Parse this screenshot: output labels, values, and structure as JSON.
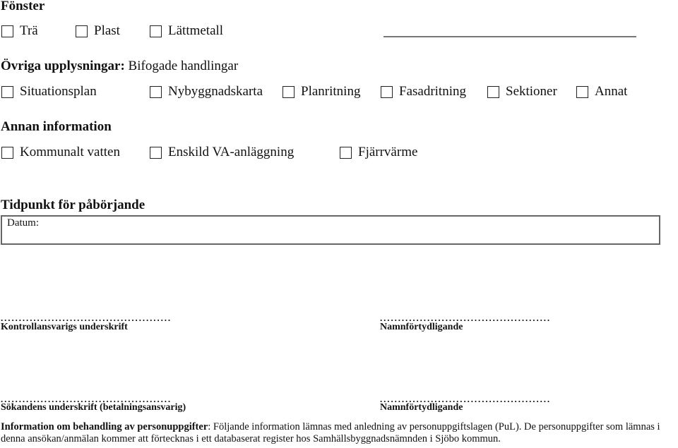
{
  "fonster": {
    "title": "Fönster",
    "options": [
      "Trä",
      "Plast",
      "Lättmetall"
    ]
  },
  "ovriga": {
    "title": "Övriga upplysningar:",
    "subtitle": "Bifogade handlingar",
    "options": [
      "Situationsplan",
      "Nybyggnadskarta",
      "Planritning",
      "Fasadritning",
      "Sektioner",
      "Annat"
    ]
  },
  "annan": {
    "title": "Annan information",
    "options": [
      "Kommunalt vatten",
      "Enskild VA-anläggning",
      "Fjärrvärme"
    ]
  },
  "tidpunkt": {
    "title": "Tidpunkt för påbörjande",
    "date_label": "Datum:",
    "date_value": ""
  },
  "signatures": {
    "dots": "...............................................",
    "kontroll_label": "Kontrollansvarigs underskrift",
    "namn_label_1": "Namnförtydligande",
    "sokande_label": "Sökandens underskrift  (betalningsansvarig)",
    "namn_label_2": "Namnförtydligande"
  },
  "info": {
    "bold": "Information om behandling av personuppgifter",
    "text": ": Följande information lämnas med anledning av personuppgiftslagen (PuL). De personuppgifter som lämnas i denna ansökan/anmälan kommer att förtecknas i ett databaserat register hos Samhällsbyggnadsnämnden i Sjöbo kommun."
  }
}
